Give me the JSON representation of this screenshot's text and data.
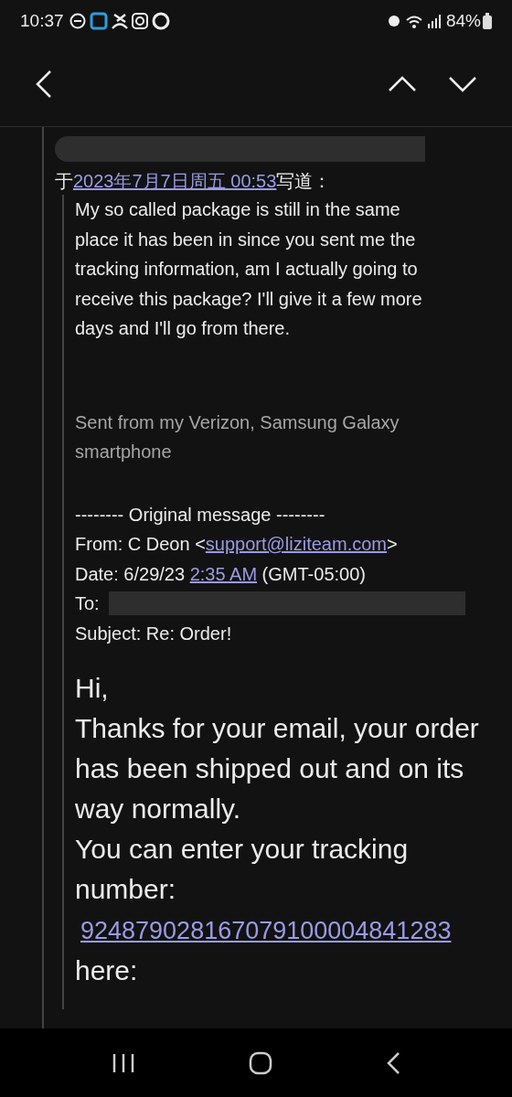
{
  "status_bar": {
    "time": "10:37",
    "battery": "84%"
  },
  "quote_header": {
    "prefix": "于",
    "date_link": "2023年7月7日周五 00:53",
    "suffix": "写道："
  },
  "reply_text": "My so called package is still in the same place it has been in since you sent me the tracking information, am I actually going to receive this package? I'll give it a few more days and I'll go from there.",
  "signature": "Sent from my Verizon, Samsung Galaxy smartphone",
  "original_message": {
    "separator": "-------- Original message --------",
    "from_label": "From: C Deon <",
    "from_email": "support@liziteam.com",
    "from_end": ">",
    "date_label": "Date: 6/29/23",
    "date_time": "2:35 AM",
    "date_zone": "(GMT-05:00)",
    "to_label": "To:",
    "subject": "Subject: Re: Order!"
  },
  "message": {
    "greeting": "Hi,",
    "body": "Thanks for your email, your order has been shipped out and on its way normally.",
    "prompt": "You can enter your tracking number:",
    "tracking_link": "924879028167079100004841283",
    "after_link": "here:"
  }
}
